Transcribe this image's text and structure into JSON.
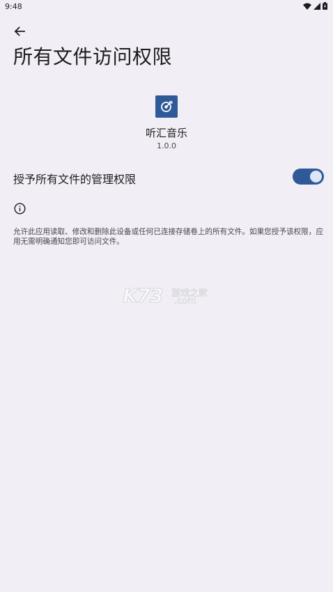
{
  "status_bar": {
    "time": "9:48"
  },
  "header": {
    "title": "所有文件访问权限"
  },
  "app": {
    "name": "听汇音乐",
    "version": "1.0.0"
  },
  "permission": {
    "label": "授予所有文件的管理权限",
    "enabled": true
  },
  "info": {
    "description": "允许此应用读取、修改和删除此设备或任何已连接存储卷上的所有文件。如果您授予该权限，应用无需明确通知您即可访问文件。"
  },
  "watermark": {
    "brand": "K73",
    "tagline": "游戏之家",
    "domain": ".com"
  },
  "colors": {
    "accent": "#2f5a98",
    "background": "#f1eff5",
    "thumb": "#dce6f6"
  },
  "icons": {
    "back": "arrow-left-icon",
    "info": "info-icon",
    "app": "music-note-icon",
    "wifi": "wifi-icon",
    "signal": "signal-icon",
    "battery": "battery-icon"
  }
}
